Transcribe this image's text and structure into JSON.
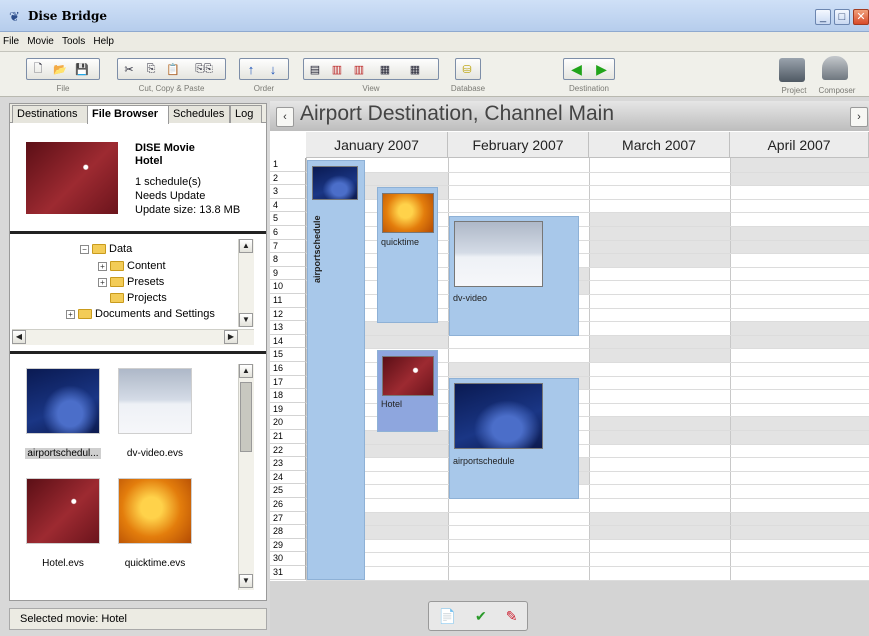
{
  "window": {
    "title": "Dise Bridge"
  },
  "menu": [
    "File",
    "Movie",
    "Tools",
    "Help"
  ],
  "toolbar": {
    "groups": [
      "File",
      "Cut, Copy & Paste",
      "Order",
      "View",
      "Database",
      "Destination"
    ],
    "right": [
      "Project",
      "Composer"
    ]
  },
  "tabs": [
    "Destinations",
    "File Browser",
    "Schedules",
    "Log"
  ],
  "movie": {
    "name": "DISE Movie",
    "title": "Hotel",
    "schedules": "1 schedule(s)",
    "status": "Needs Update",
    "size": "Update size: 13.8 MB"
  },
  "tree": {
    "items": [
      "Data",
      "Content",
      "Presets",
      "Projects",
      "Documents and Settings"
    ]
  },
  "files": [
    "airportschedul...",
    "dv-video.evs",
    "Hotel.evs",
    "quicktime.evs"
  ],
  "status_text": "Selected movie: Hotel",
  "calendar": {
    "title": "Airport Destination, Channel Main",
    "months": [
      "January 2007",
      "February 2007",
      "March 2007",
      "April 2007"
    ],
    "days": [
      "1",
      "2",
      "3",
      "4",
      "5",
      "6",
      "7",
      "8",
      "9",
      "10",
      "11",
      "12",
      "13",
      "14",
      "15",
      "16",
      "17",
      "18",
      "19",
      "20",
      "21",
      "22",
      "23",
      "24",
      "25",
      "26",
      "27",
      "28",
      "29",
      "30",
      "31"
    ],
    "blocks": [
      "airportschedule",
      "quicktime",
      "dv-video",
      "Hotel",
      "airportschedule"
    ]
  }
}
